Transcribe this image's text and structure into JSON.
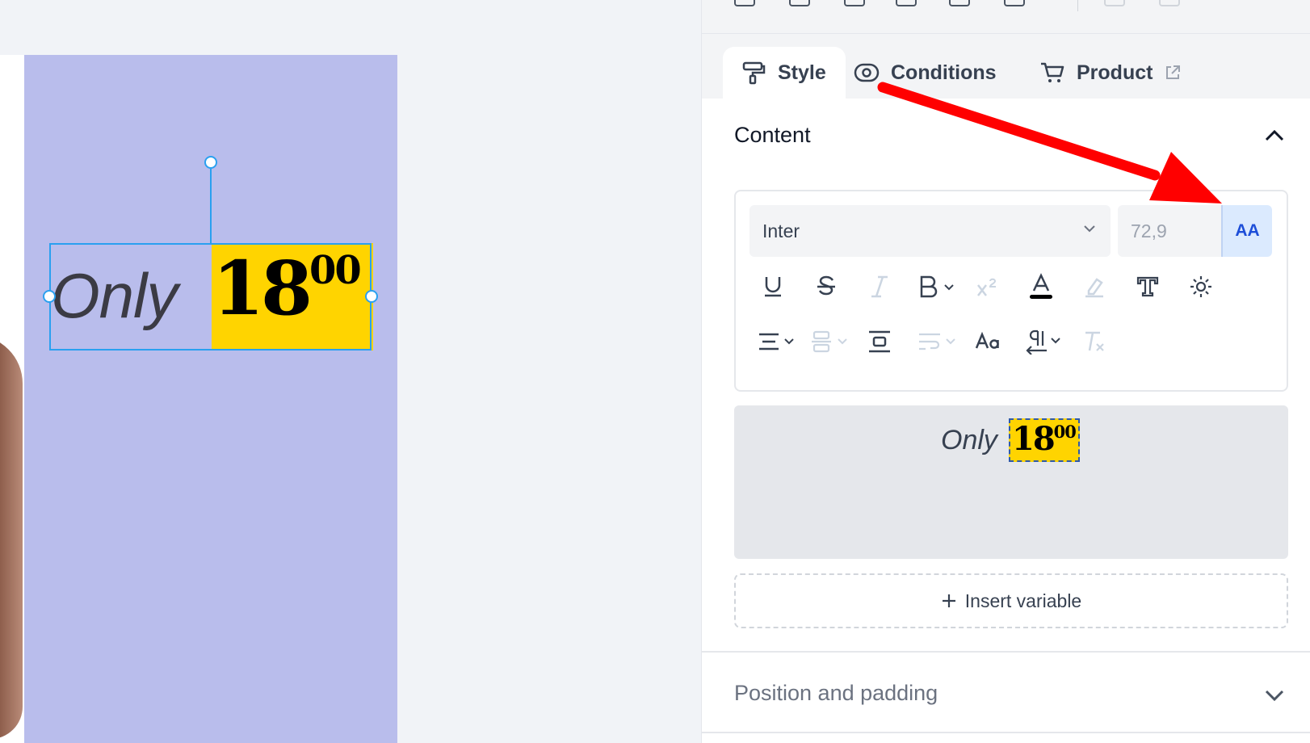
{
  "canvas": {
    "only_text": "Only",
    "price_main": "18",
    "price_sup": "00",
    "artboard_color": "#b9bdec",
    "highlight_color": "#ffd400"
  },
  "toolbar": {
    "icons": [
      "align-left-icon",
      "align-center-icon",
      "align-right-icon",
      "align-top-icon",
      "align-middle-icon",
      "align-bottom-icon",
      "distribute-icon",
      "more-icon"
    ]
  },
  "tabs": [
    {
      "label": "Style",
      "icon": "paint-roller-icon",
      "active": true
    },
    {
      "label": "Conditions",
      "icon": "eye-icon",
      "active": false
    },
    {
      "label": "Product",
      "icon": "cart-icon",
      "active": false
    }
  ],
  "content_section": {
    "title": "Content",
    "font_family": "Inter",
    "font_size": "72,9",
    "aa_label": "AA"
  },
  "preview": {
    "only_text": "Only",
    "price_main": "18",
    "price_sup": "00"
  },
  "insert_variable": {
    "label": "Insert variable"
  },
  "position_section": {
    "title": "Position and padding"
  },
  "colors": {
    "accent": "#2aa0f0",
    "arrow": "#ff0000"
  }
}
